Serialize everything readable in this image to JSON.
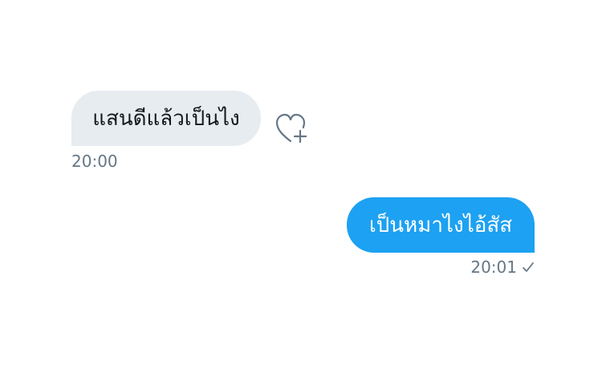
{
  "conversation": {
    "incoming_message": {
      "text": "แสนดีแล้วเป็นไง",
      "timestamp": "20:00",
      "reaction_icon": "heart-plus-icon"
    },
    "outgoing_message": {
      "text": "เป็นหมาไงไอ้สัส",
      "timestamp": "20:01",
      "status_icon": "checkmark-icon"
    }
  },
  "colors": {
    "incoming_bubble": "#e6ecf0",
    "outgoing_bubble": "#1da1f2",
    "timestamp_text": "#657786",
    "incoming_text": "#14171a",
    "outgoing_text": "#ffffff"
  }
}
